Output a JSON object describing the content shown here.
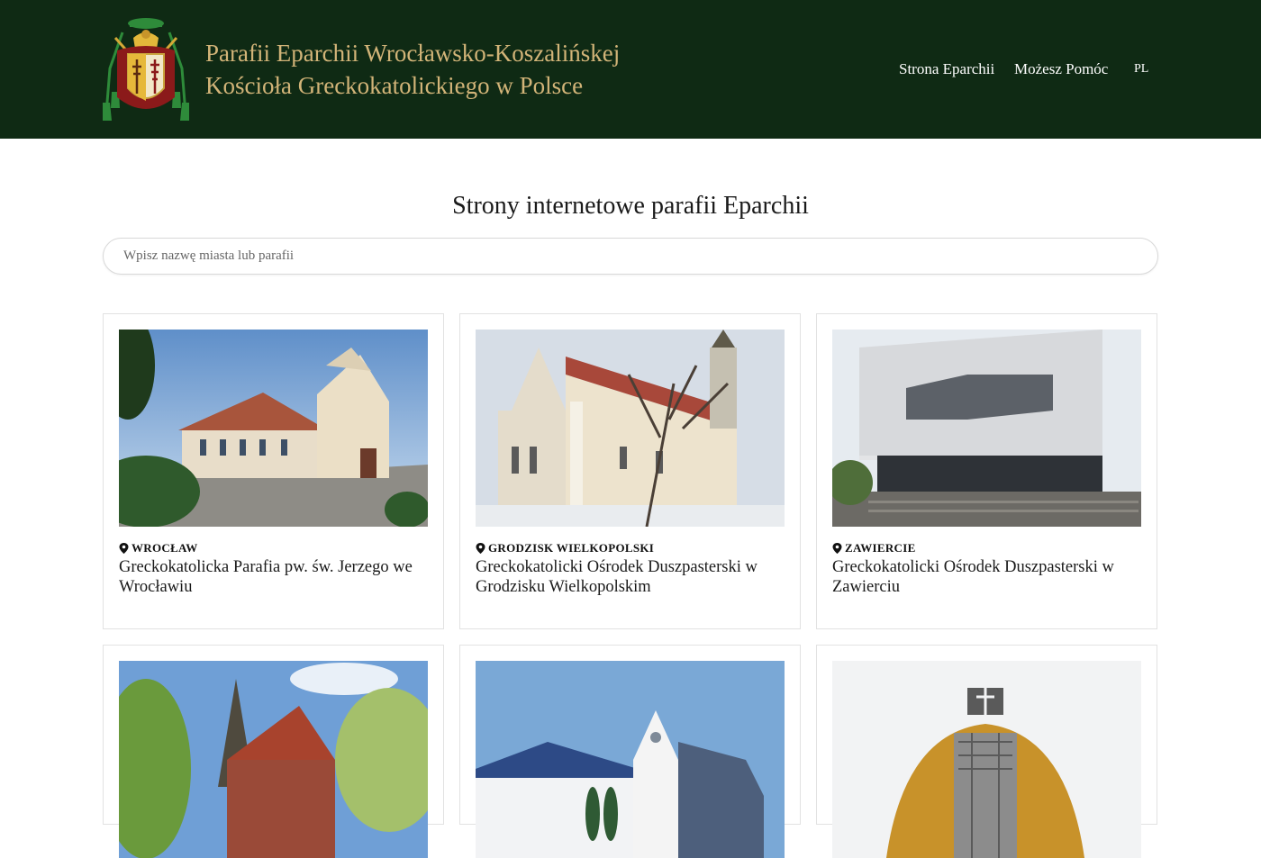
{
  "header": {
    "title_line1": "Parafii Eparchii Wrocławsko-Koszalińskej",
    "title_line2": "Kościoła Greckokatolickiego w Polsce",
    "nav": [
      {
        "label": "Strona Eparchii"
      },
      {
        "label": "Możesz Pomóc"
      }
    ],
    "language": "PL"
  },
  "main": {
    "heading": "Strony internetowe parafii Eparchii",
    "search": {
      "placeholder": "Wpisz nazwę miasta lub parafii",
      "value": ""
    },
    "parishes": [
      {
        "city": "WROCŁAW",
        "name": "Greckokatolicka Parafia pw. św. Jerzego we Wrocławiu"
      },
      {
        "city": "GRODZISK WIELKOPOLSKI",
        "name": "Greckokatolicki Ośrodek Duszpasterski w Grodzisku Wielkopolskim"
      },
      {
        "city": "ZAWIERCIE",
        "name": "Greckokatolicki Ośrodek Duszpasterski w Zawierciu"
      },
      {
        "city": "",
        "name": ""
      },
      {
        "city": "",
        "name": ""
      },
      {
        "city": "",
        "name": ""
      }
    ]
  },
  "colors": {
    "header_bg": "#0f2a14",
    "title_gold": "#d2b478",
    "border": "#e2e2e2"
  }
}
